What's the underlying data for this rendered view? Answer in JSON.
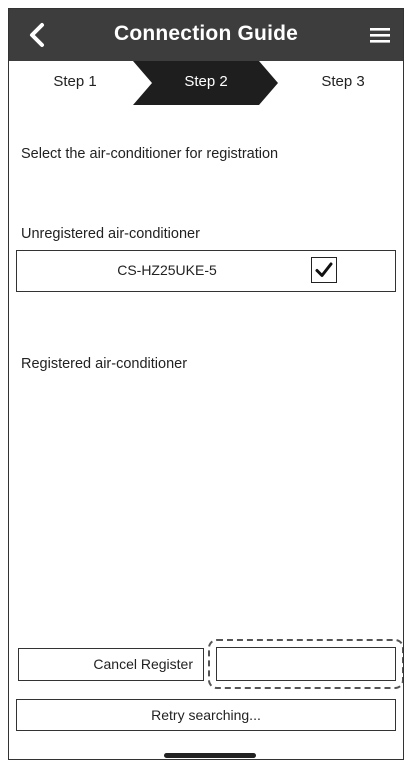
{
  "header": {
    "title": "Connection Guide",
    "back_icon": "chevron-left-icon",
    "menu_icon": "hamburger-menu-icon"
  },
  "steps": {
    "items": [
      "Step 1",
      "Step 2",
      "Step 3"
    ],
    "active_index": 1
  },
  "content": {
    "instruction": "Select the air-conditioner for registration",
    "unregistered_label": "Unregistered air-conditioner",
    "unregistered_devices": [
      {
        "name": "CS-HZ25UKE-5",
        "checked": true
      }
    ],
    "registered_label": "Registered air-conditioner"
  },
  "buttons": {
    "cancel_register": "Cancel Register",
    "register": "",
    "retry_searching": "Retry searching..."
  },
  "colors": {
    "header_bg": "#3d3d3d",
    "active_step_bg": "#1e1e1e",
    "text": "#222222"
  }
}
